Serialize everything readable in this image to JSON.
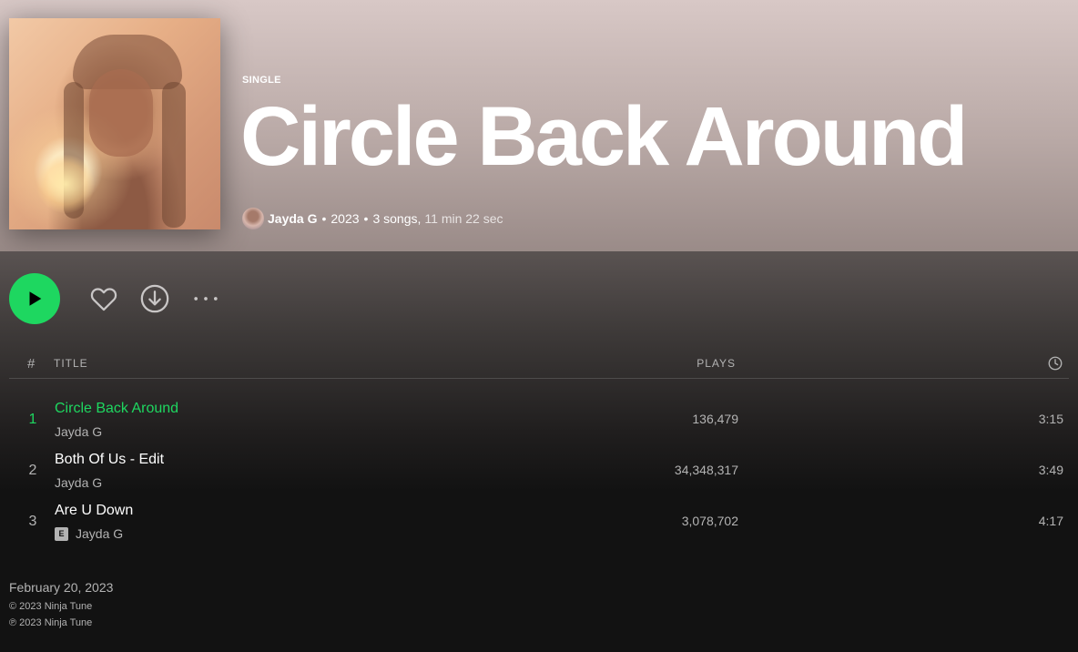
{
  "album": {
    "type_label": "SINGLE",
    "title": "Circle Back Around",
    "artist": "Jayda G",
    "year": "2023",
    "song_count": "3 songs,",
    "duration": "11 min 22 sec",
    "cover_icon": "album-cover-art"
  },
  "actions": {
    "play_icon": "play-icon",
    "like_icon": "heart-icon",
    "download_icon": "download-icon",
    "more_icon": "more-icon"
  },
  "tracklist_header": {
    "num": "#",
    "title": "TITLE",
    "plays": "PLAYS",
    "duration_icon": "clock-icon"
  },
  "tracks": [
    {
      "num": "1",
      "title": "Circle Back Around",
      "artist": "Jayda G",
      "plays": "136,479",
      "duration": "3:15",
      "explicit": false,
      "active": true
    },
    {
      "num": "2",
      "title": "Both Of Us - Edit",
      "artist": "Jayda G",
      "plays": "34,348,317",
      "duration": "3:49",
      "explicit": false,
      "active": false
    },
    {
      "num": "3",
      "title": "Are U Down",
      "artist": "Jayda G",
      "plays": "3,078,702",
      "duration": "4:17",
      "explicit": true,
      "explicit_label": "E",
      "active": false
    }
  ],
  "footer": {
    "release_date": "February 20, 2023",
    "copyright": "© 2023 Ninja Tune",
    "phonogram": "℗ 2023 Ninja Tune"
  },
  "colors": {
    "accent": "#1ed760",
    "background": "#121212",
    "hero_top": "#d8c8c6",
    "text_muted": "#b3b3b3"
  }
}
